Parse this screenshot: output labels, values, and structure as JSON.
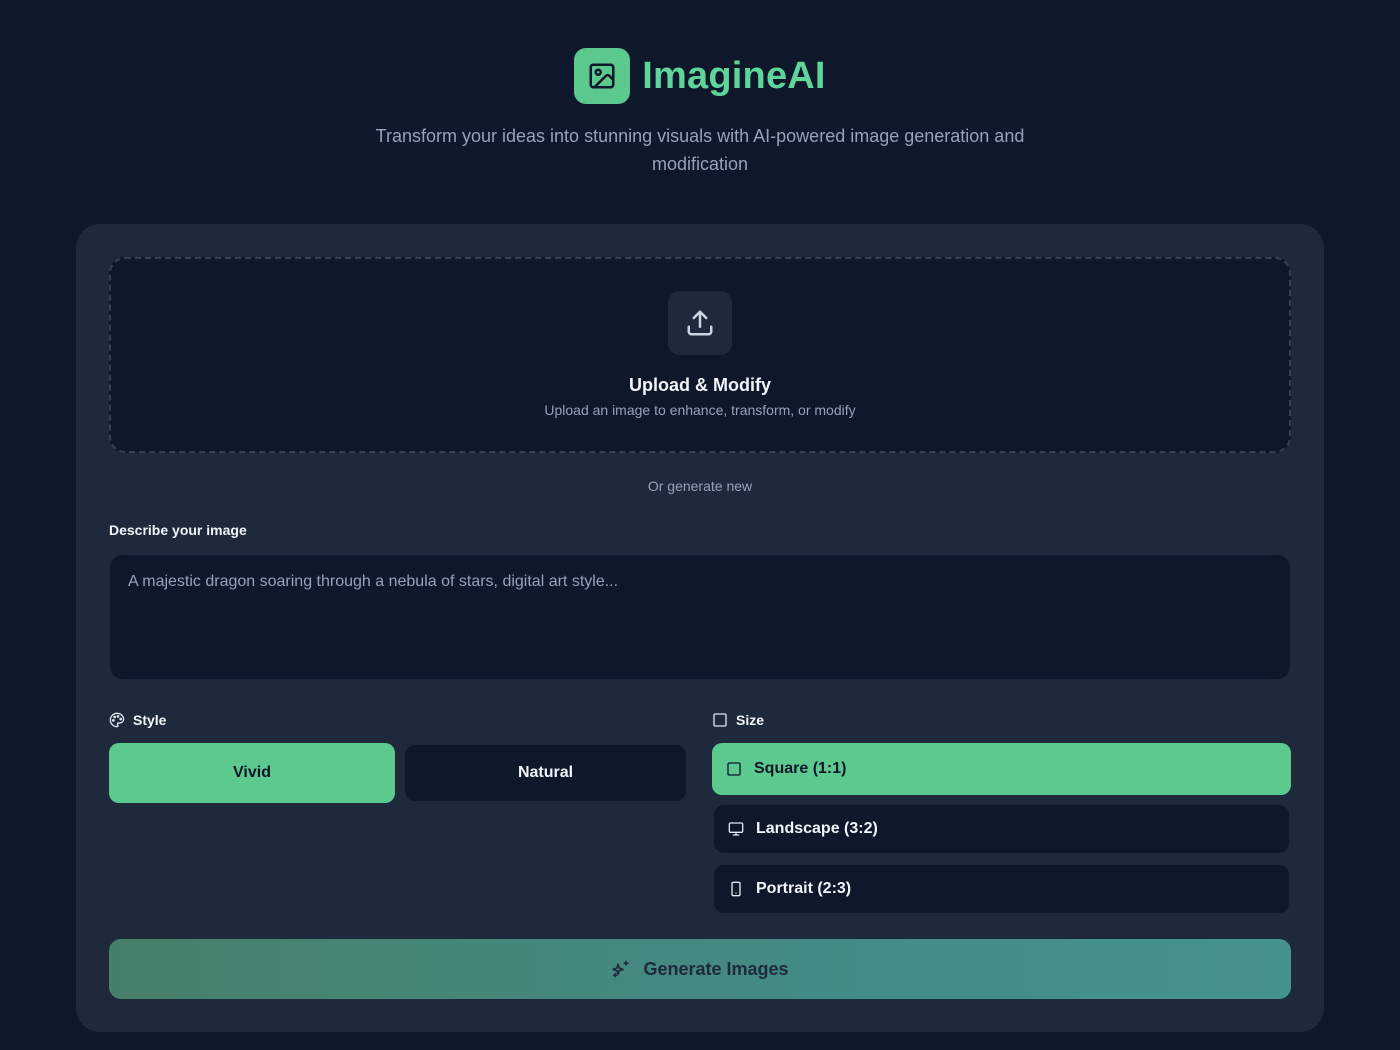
{
  "app": {
    "name": "ImagineAI",
    "tagline": "Transform your ideas into stunning visuals with AI-powered image generation and modification",
    "logo_icon": "image-icon",
    "accent_color": "#5cc98e"
  },
  "upload": {
    "icon": "upload-icon",
    "title": "Upload & Modify",
    "subtitle": "Upload an image to enhance, transform, or modify"
  },
  "divider_text": "Or generate new",
  "prompt": {
    "label": "Describe your image",
    "placeholder": "A majestic dragon soaring through a nebula of stars, digital art style...",
    "value": ""
  },
  "style": {
    "label": "Style",
    "icon": "palette-icon",
    "options": [
      {
        "label": "Vivid",
        "selected": true
      },
      {
        "label": "Natural",
        "selected": false
      }
    ]
  },
  "size": {
    "label": "Size",
    "icon": "square-icon",
    "options": [
      {
        "label": "Square (1:1)",
        "icon": "square-icon",
        "selected": true
      },
      {
        "label": "Landscape (3:2)",
        "icon": "monitor-icon",
        "selected": false
      },
      {
        "label": "Portrait (2:3)",
        "icon": "smartphone-icon",
        "selected": false
      }
    ]
  },
  "generate": {
    "label": "Generate Images",
    "icon": "sparkles-icon"
  }
}
